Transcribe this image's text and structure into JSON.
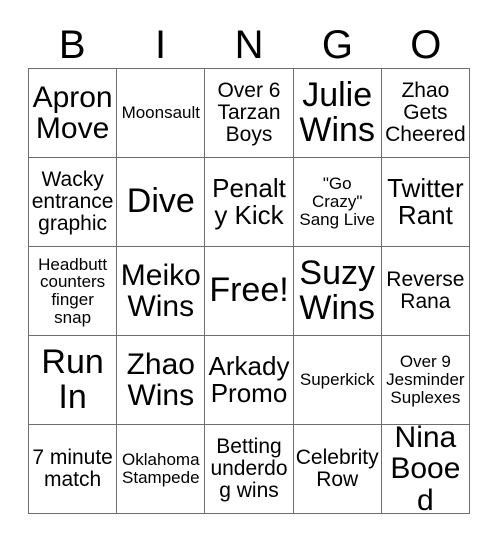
{
  "card": {
    "title_letters": [
      "B",
      "I",
      "N",
      "G",
      "O"
    ],
    "rows": [
      [
        {
          "text": "Apron Move",
          "size": "fs-xl"
        },
        {
          "text": "Moonsault",
          "size": "fs-sm"
        },
        {
          "text": "Over 6 Tarzan Boys",
          "size": "fs-md"
        },
        {
          "text": "Julie Wins",
          "size": "fs-xxl"
        },
        {
          "text": "Zhao Gets Cheered",
          "size": "fs-md"
        }
      ],
      [
        {
          "text": "Wacky entrance graphic",
          "size": "fs-md"
        },
        {
          "text": "Dive",
          "size": "fs-xxl"
        },
        {
          "text": "Penalty Kick",
          "size": "fs-lg"
        },
        {
          "text": "\"Go Crazy\" Sang Live",
          "size": "fs-sm"
        },
        {
          "text": "Twitter Rant",
          "size": "fs-lg"
        }
      ],
      [
        {
          "text": "Headbutt counters finger snap",
          "size": "fs-sm"
        },
        {
          "text": "Meiko Wins",
          "size": "fs-xl"
        },
        {
          "text": "Free!",
          "size": "fs-xxl"
        },
        {
          "text": "Suzy Wins",
          "size": "fs-xxl"
        },
        {
          "text": "Reverse Rana",
          "size": "fs-md"
        }
      ],
      [
        {
          "text": "Run In",
          "size": "fs-xxl"
        },
        {
          "text": "Zhao Wins",
          "size": "fs-xl"
        },
        {
          "text": "Arkady Promo",
          "size": "fs-lg"
        },
        {
          "text": "Superkick",
          "size": "fs-sm"
        },
        {
          "text": "Over 9 Jesminder Suplexes",
          "size": "fs-sm"
        }
      ],
      [
        {
          "text": "7 minute match",
          "size": "fs-md"
        },
        {
          "text": "Oklahoma Stampede",
          "size": "fs-sm"
        },
        {
          "text": "Betting underdog wins",
          "size": "fs-md"
        },
        {
          "text": "Celebrity Row",
          "size": "fs-md"
        },
        {
          "text": "Nina Booed",
          "size": "fs-xl"
        }
      ]
    ]
  },
  "colors": {
    "background": "#ffffff",
    "text": "#000000",
    "grid_line": "#6e6e6e"
  }
}
